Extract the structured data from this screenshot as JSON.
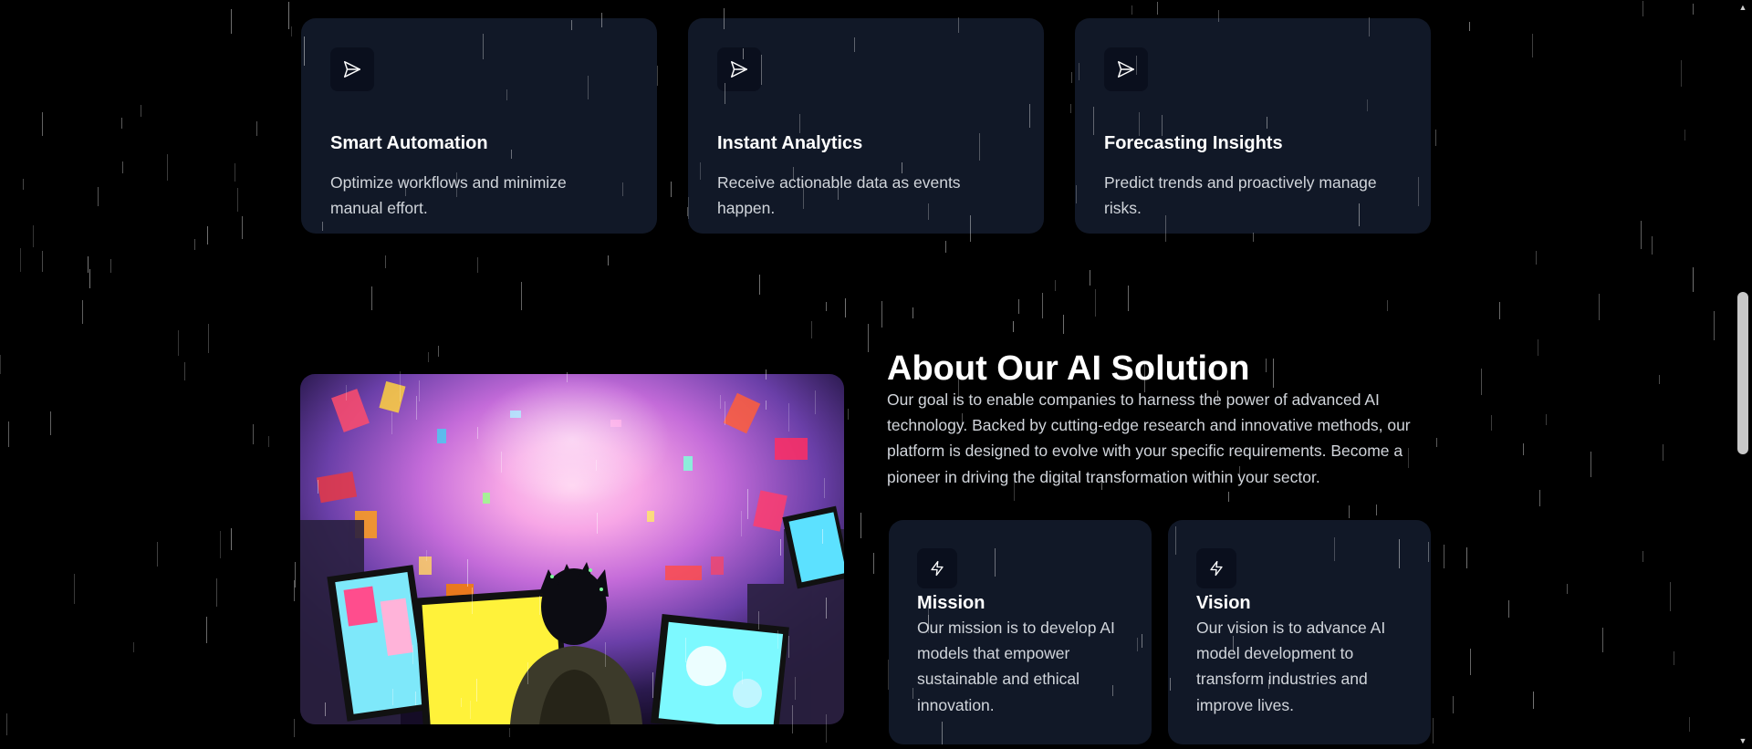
{
  "features": [
    {
      "icon": "send-icon",
      "title": "Smart Automation",
      "description": "Optimize workflows and minimize manual effort."
    },
    {
      "icon": "send-icon",
      "title": "Instant Analytics",
      "description": "Receive actionable data as events happen."
    },
    {
      "icon": "send-icon",
      "title": "Forecasting Insights",
      "description": "Predict trends and proactively manage risks."
    }
  ],
  "about": {
    "heading": "About Our AI Solution",
    "text": "Our goal is to enable companies to harness the power of advanced AI technology. Backed by cutting-edge research and innovative methods, our platform is designed to evolve with your specific requirements. Become a pioneer in driving the digital transformation within your sector.",
    "image": "illustration of a person facing glowing monitors inside a neon data tunnel",
    "cards": [
      {
        "icon": "lightning-icon",
        "title": "Mission",
        "description": "Our mission is to develop AI models that empower sustainable and ethical innovation."
      },
      {
        "icon": "lightning-icon",
        "title": "Vision",
        "description": "Our vision is to advance AI model development to transform industries and improve lives."
      }
    ]
  },
  "colors": {
    "page_background": "#000000",
    "card_background": "#111827",
    "icon_background": "#0a0f1d",
    "body_text": "#d1d5db"
  }
}
